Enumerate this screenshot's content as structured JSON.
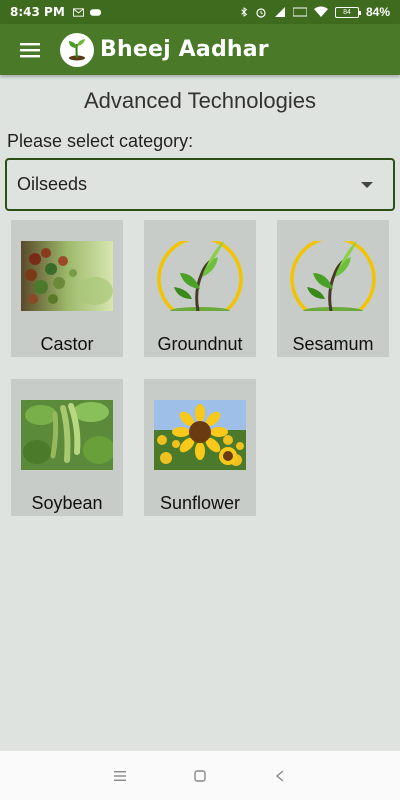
{
  "status_bar": {
    "time": "8:43 PM",
    "battery_percent": "84%",
    "battery_label": "84"
  },
  "app_bar": {
    "title": "Bheej Aadhar",
    "menu_icon": "hamburger-menu-icon",
    "logo_icon": "sprout-logo-icon"
  },
  "page": {
    "title": "Advanced Technologies",
    "select_label": "Please select category:",
    "category_value": "Oilseeds"
  },
  "crops": [
    {
      "label": "Castor",
      "image": "castor-plant-photo"
    },
    {
      "label": "Groundnut",
      "image": "sapling-placeholder-icon"
    },
    {
      "label": "Sesamum",
      "image": "sapling-placeholder-icon"
    },
    {
      "label": "Soybean",
      "image": "soybean-pods-photo"
    },
    {
      "label": "Sunflower",
      "image": "sunflower-field-photo"
    }
  ],
  "colors": {
    "app_bar": "#4a7a28",
    "status_bar": "#3f6b1f",
    "background": "#dfe3df",
    "tile": "#c8ccc8"
  }
}
